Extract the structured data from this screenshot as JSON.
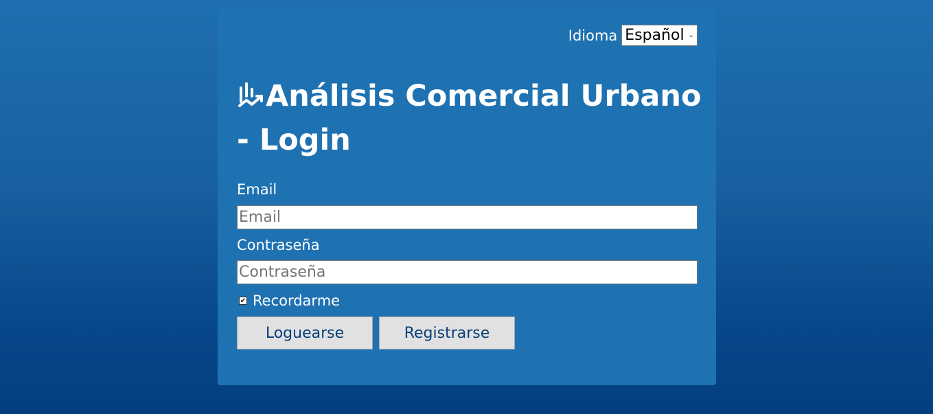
{
  "language": {
    "label": "Idioma",
    "selected": "Español"
  },
  "title": "Análisis Comercial Urbano - Login",
  "title_icon": "chart-trend-icon",
  "form": {
    "email_label": "Email",
    "email_placeholder": "Email",
    "email_value": "",
    "password_label": "Contraseña",
    "password_placeholder": "Contraseña",
    "password_value": "",
    "remember_label": "Recordarme",
    "remember_checked": true
  },
  "buttons": {
    "login": "Loguearse",
    "register": "Registrarse"
  },
  "colors": {
    "background_top": "#1f6fb0",
    "background_bottom": "#033f7f",
    "card": "#1f72b2",
    "button_text": "#083f7a",
    "button_bg": "#e1e1e1"
  }
}
